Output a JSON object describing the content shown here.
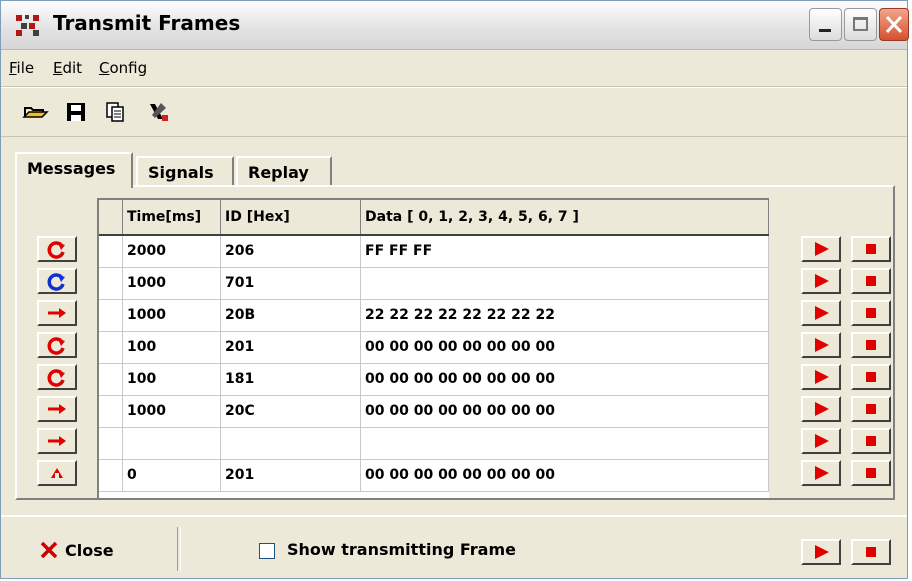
{
  "window": {
    "title": "Transmit Frames"
  },
  "menu": [
    {
      "label": "File"
    },
    {
      "label": "Edit"
    },
    {
      "label": "Config"
    }
  ],
  "toolbar": {
    "icons": [
      "open-folder-icon",
      "save-icon",
      "copy-icon",
      "configure-icon"
    ]
  },
  "tabs": [
    {
      "label": "Messages",
      "active": true
    },
    {
      "label": "Signals",
      "active": false
    },
    {
      "label": "Replay",
      "active": false
    }
  ],
  "grid": {
    "columns": [
      "Time[ms]",
      "ID [Hex]",
      "Data [ 0, 1, 2, 3, 4, 5, 6, 7 ]"
    ],
    "rows": [
      {
        "mode": "cyclic-red",
        "time": "2000",
        "id": "206",
        "data": "FF FF FF"
      },
      {
        "mode": "cyclic-blue",
        "time": "1000",
        "id": "701",
        "data": ""
      },
      {
        "mode": "arrow",
        "time": "1000",
        "id": "20B",
        "data": "22 22 22 22 22 22 22 22"
      },
      {
        "mode": "cyclic-red",
        "time": "100",
        "id": "201",
        "data": "00 00 00 00 00 00 00 00"
      },
      {
        "mode": "cyclic-red",
        "time": "100",
        "id": "181",
        "data": "00 00 00 00 00 00 00 00"
      },
      {
        "mode": "arrow",
        "time": "1000",
        "id": "20C",
        "data": "00 00 00 00 00 00 00 00"
      },
      {
        "mode": "arrow",
        "time": "",
        "id": "",
        "data": ""
      },
      {
        "mode": "triangle",
        "time": "0",
        "id": "201",
        "data": "00 00 00 00 00 00 00 00"
      }
    ]
  },
  "footer": {
    "close_label": "Close",
    "show_label": "Show transmitting Frame",
    "show_checked": false
  },
  "colors": {
    "accent_red": "#e00000",
    "cyclic_blue": "#1030d0"
  }
}
